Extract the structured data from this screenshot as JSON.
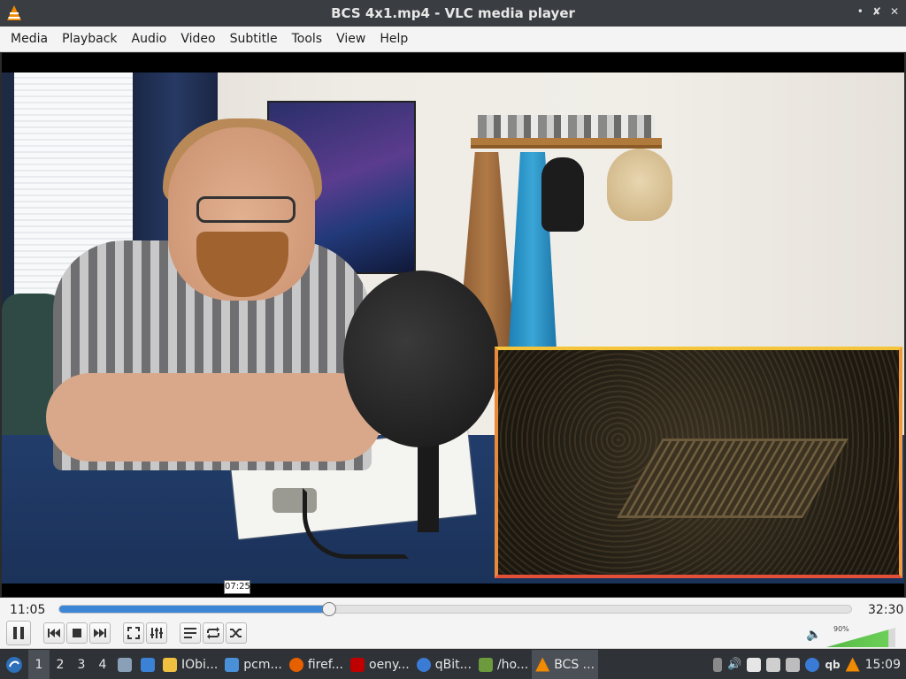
{
  "window": {
    "title": "BCS 4x1.mp4 - VLC media player",
    "buttons": [
      "•",
      "✖",
      "✕"
    ]
  },
  "menu": [
    "Media",
    "Playback",
    "Audio",
    "Video",
    "Subtitle",
    "Tools",
    "View",
    "Help"
  ],
  "player": {
    "elapsed": "11:05",
    "total": "32:30",
    "progress": 0.341,
    "hover_time": "07:25",
    "volume_label": "90%",
    "volume_level": 0.9
  },
  "controls": {
    "pause": "pause",
    "previous": "previous",
    "stop": "stop",
    "next": "next",
    "fullscreen": "fullscreen",
    "extended_settings": "extended-settings",
    "playlist": "playlist",
    "loop": "loop",
    "shuffle": "shuffle"
  },
  "taskbar": {
    "workspaces": [
      "1",
      "2",
      "3",
      "4"
    ],
    "tasks": [
      {
        "label": "IObi...",
        "icon": "lock-icon",
        "color": "#f0c040"
      },
      {
        "label": "pcm...",
        "icon": "folder-icon",
        "color": "#4a90d9"
      },
      {
        "label": "firef...",
        "icon": "firefox-icon",
        "color": "#e66000"
      },
      {
        "label": "oeny...",
        "icon": "filezilla-icon",
        "color": "#bf0000"
      },
      {
        "label": "qBit...",
        "icon": "qbittorrent-icon",
        "color": "#3a7bd5"
      },
      {
        "label": "/ho...",
        "icon": "archive-icon",
        "color": "#6c9a3c"
      },
      {
        "label": "BCS ...",
        "icon": "vlc-icon",
        "color": "#f08a00"
      }
    ],
    "clock": "15:09",
    "tray_qb": "qb"
  }
}
